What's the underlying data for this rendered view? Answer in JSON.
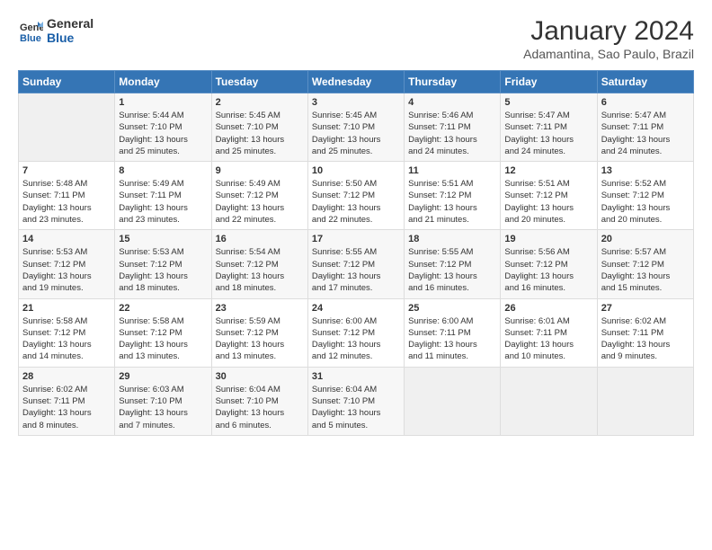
{
  "logo": {
    "line1": "General",
    "line2": "Blue"
  },
  "title": "January 2024",
  "subtitle": "Adamantina, Sao Paulo, Brazil",
  "header_days": [
    "Sunday",
    "Monday",
    "Tuesday",
    "Wednesday",
    "Thursday",
    "Friday",
    "Saturday"
  ],
  "weeks": [
    [
      {
        "day": "",
        "info": ""
      },
      {
        "day": "1",
        "info": "Sunrise: 5:44 AM\nSunset: 7:10 PM\nDaylight: 13 hours\nand 25 minutes."
      },
      {
        "day": "2",
        "info": "Sunrise: 5:45 AM\nSunset: 7:10 PM\nDaylight: 13 hours\nand 25 minutes."
      },
      {
        "day": "3",
        "info": "Sunrise: 5:45 AM\nSunset: 7:10 PM\nDaylight: 13 hours\nand 25 minutes."
      },
      {
        "day": "4",
        "info": "Sunrise: 5:46 AM\nSunset: 7:11 PM\nDaylight: 13 hours\nand 24 minutes."
      },
      {
        "day": "5",
        "info": "Sunrise: 5:47 AM\nSunset: 7:11 PM\nDaylight: 13 hours\nand 24 minutes."
      },
      {
        "day": "6",
        "info": "Sunrise: 5:47 AM\nSunset: 7:11 PM\nDaylight: 13 hours\nand 24 minutes."
      }
    ],
    [
      {
        "day": "7",
        "info": "Sunrise: 5:48 AM\nSunset: 7:11 PM\nDaylight: 13 hours\nand 23 minutes."
      },
      {
        "day": "8",
        "info": "Sunrise: 5:49 AM\nSunset: 7:11 PM\nDaylight: 13 hours\nand 23 minutes."
      },
      {
        "day": "9",
        "info": "Sunrise: 5:49 AM\nSunset: 7:12 PM\nDaylight: 13 hours\nand 22 minutes."
      },
      {
        "day": "10",
        "info": "Sunrise: 5:50 AM\nSunset: 7:12 PM\nDaylight: 13 hours\nand 22 minutes."
      },
      {
        "day": "11",
        "info": "Sunrise: 5:51 AM\nSunset: 7:12 PM\nDaylight: 13 hours\nand 21 minutes."
      },
      {
        "day": "12",
        "info": "Sunrise: 5:51 AM\nSunset: 7:12 PM\nDaylight: 13 hours\nand 20 minutes."
      },
      {
        "day": "13",
        "info": "Sunrise: 5:52 AM\nSunset: 7:12 PM\nDaylight: 13 hours\nand 20 minutes."
      }
    ],
    [
      {
        "day": "14",
        "info": "Sunrise: 5:53 AM\nSunset: 7:12 PM\nDaylight: 13 hours\nand 19 minutes."
      },
      {
        "day": "15",
        "info": "Sunrise: 5:53 AM\nSunset: 7:12 PM\nDaylight: 13 hours\nand 18 minutes."
      },
      {
        "day": "16",
        "info": "Sunrise: 5:54 AM\nSunset: 7:12 PM\nDaylight: 13 hours\nand 18 minutes."
      },
      {
        "day": "17",
        "info": "Sunrise: 5:55 AM\nSunset: 7:12 PM\nDaylight: 13 hours\nand 17 minutes."
      },
      {
        "day": "18",
        "info": "Sunrise: 5:55 AM\nSunset: 7:12 PM\nDaylight: 13 hours\nand 16 minutes."
      },
      {
        "day": "19",
        "info": "Sunrise: 5:56 AM\nSunset: 7:12 PM\nDaylight: 13 hours\nand 16 minutes."
      },
      {
        "day": "20",
        "info": "Sunrise: 5:57 AM\nSunset: 7:12 PM\nDaylight: 13 hours\nand 15 minutes."
      }
    ],
    [
      {
        "day": "21",
        "info": "Sunrise: 5:58 AM\nSunset: 7:12 PM\nDaylight: 13 hours\nand 14 minutes."
      },
      {
        "day": "22",
        "info": "Sunrise: 5:58 AM\nSunset: 7:12 PM\nDaylight: 13 hours\nand 13 minutes."
      },
      {
        "day": "23",
        "info": "Sunrise: 5:59 AM\nSunset: 7:12 PM\nDaylight: 13 hours\nand 13 minutes."
      },
      {
        "day": "24",
        "info": "Sunrise: 6:00 AM\nSunset: 7:12 PM\nDaylight: 13 hours\nand 12 minutes."
      },
      {
        "day": "25",
        "info": "Sunrise: 6:00 AM\nSunset: 7:11 PM\nDaylight: 13 hours\nand 11 minutes."
      },
      {
        "day": "26",
        "info": "Sunrise: 6:01 AM\nSunset: 7:11 PM\nDaylight: 13 hours\nand 10 minutes."
      },
      {
        "day": "27",
        "info": "Sunrise: 6:02 AM\nSunset: 7:11 PM\nDaylight: 13 hours\nand 9 minutes."
      }
    ],
    [
      {
        "day": "28",
        "info": "Sunrise: 6:02 AM\nSunset: 7:11 PM\nDaylight: 13 hours\nand 8 minutes."
      },
      {
        "day": "29",
        "info": "Sunrise: 6:03 AM\nSunset: 7:10 PM\nDaylight: 13 hours\nand 7 minutes."
      },
      {
        "day": "30",
        "info": "Sunrise: 6:04 AM\nSunset: 7:10 PM\nDaylight: 13 hours\nand 6 minutes."
      },
      {
        "day": "31",
        "info": "Sunrise: 6:04 AM\nSunset: 7:10 PM\nDaylight: 13 hours\nand 5 minutes."
      },
      {
        "day": "",
        "info": ""
      },
      {
        "day": "",
        "info": ""
      },
      {
        "day": "",
        "info": ""
      }
    ]
  ]
}
